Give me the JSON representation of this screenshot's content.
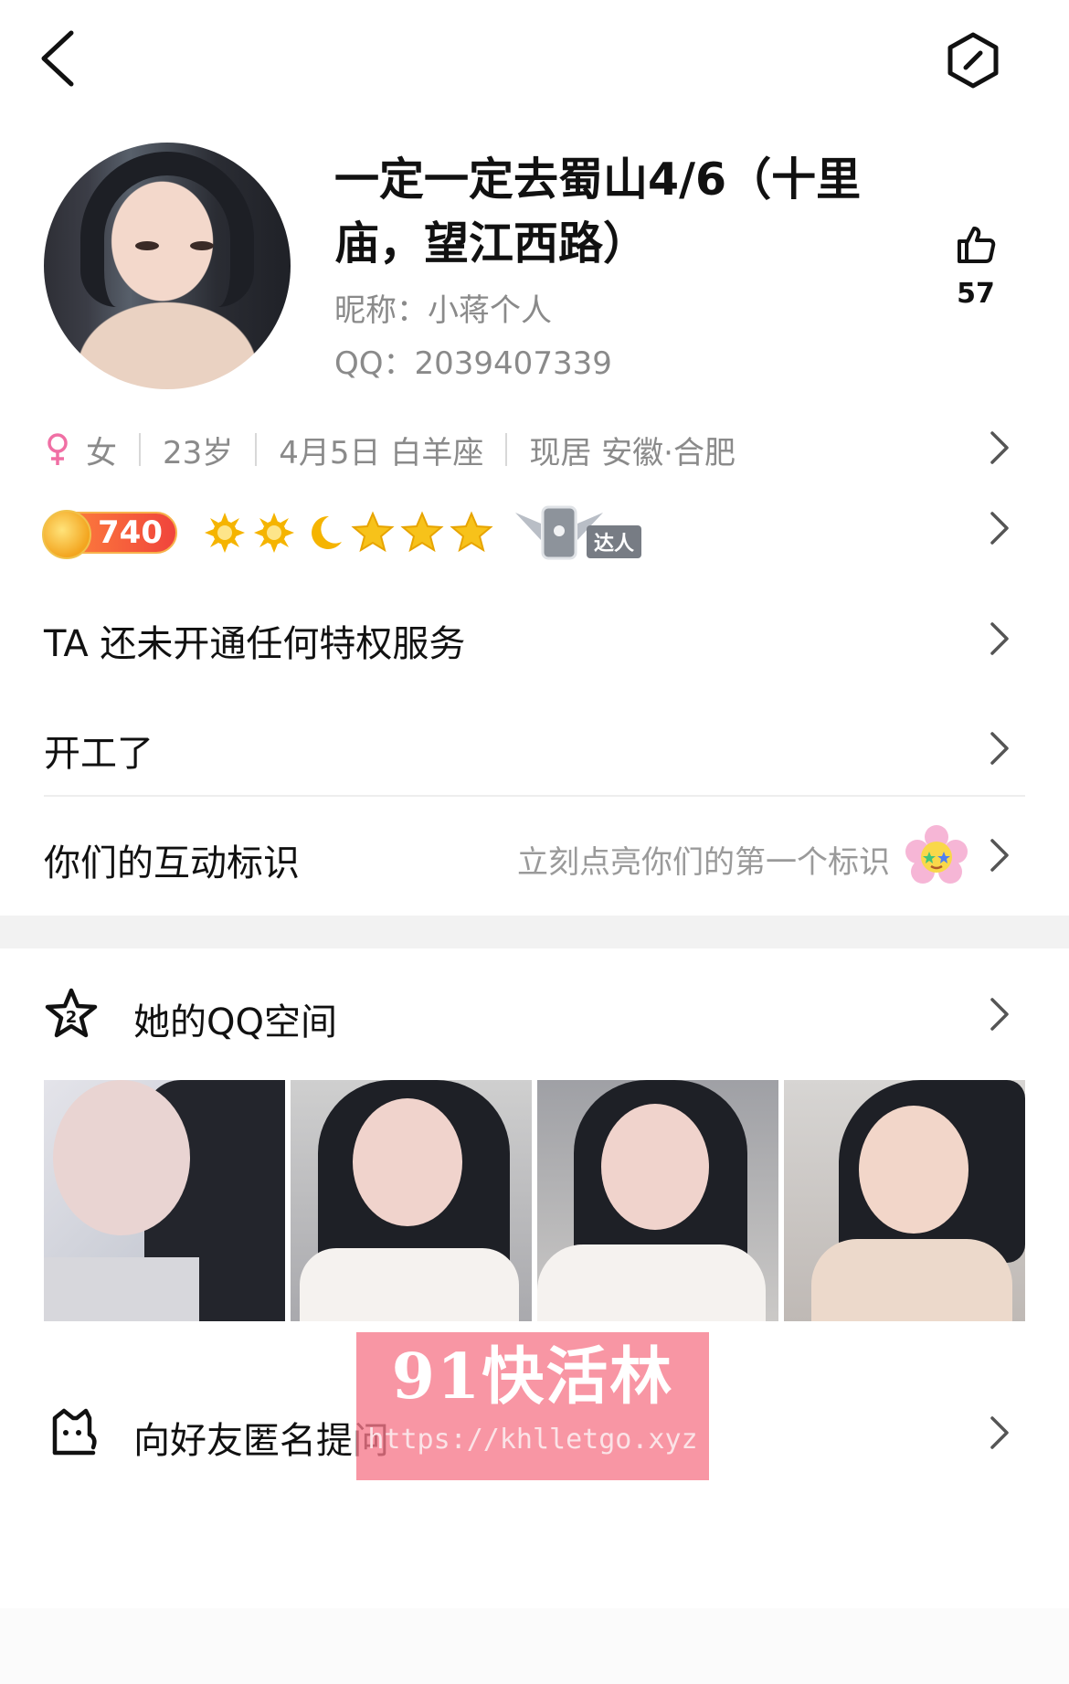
{
  "header": {
    "back_icon": "chevron-left-icon",
    "settings_icon": "hexagon-settings-icon"
  },
  "profile": {
    "display_name": "一定一定去蜀山4/6（十里庙，望江西路）",
    "nickname_line": "昵称：小蒋个人",
    "qq_line": "QQ：2039407339",
    "like_icon": "thumbs-up-icon",
    "like_count": "57"
  },
  "info": {
    "gender_icon": "female-icon",
    "gender": "女",
    "age": "23岁",
    "birthday": "4月5日 白羊座",
    "location": "现居 安徽·合肥"
  },
  "level": {
    "value": "740",
    "icons": [
      "sun-icon",
      "sun-icon",
      "moon-icon",
      "star-icon",
      "star-icon",
      "star-icon"
    ],
    "master_label": "达人",
    "colors": {
      "badge": "#f0443c",
      "sun": "#f5b400",
      "star": "#f7c21a"
    }
  },
  "menu": {
    "privilege": "TA 还未开通任何特权服务",
    "signature": "开工了",
    "interaction_title": "你们的互动标识",
    "interaction_hint": "立刻点亮你们的第一个标识"
  },
  "qzone": {
    "icon": "star-2-icon",
    "title": "她的QQ空间",
    "photo_count": 4
  },
  "anonymous": {
    "icon": "cat-icon",
    "title": "向好友匿名提问"
  },
  "watermark": {
    "brand": "91快活林",
    "url": "https://khlletgo.xyz"
  }
}
